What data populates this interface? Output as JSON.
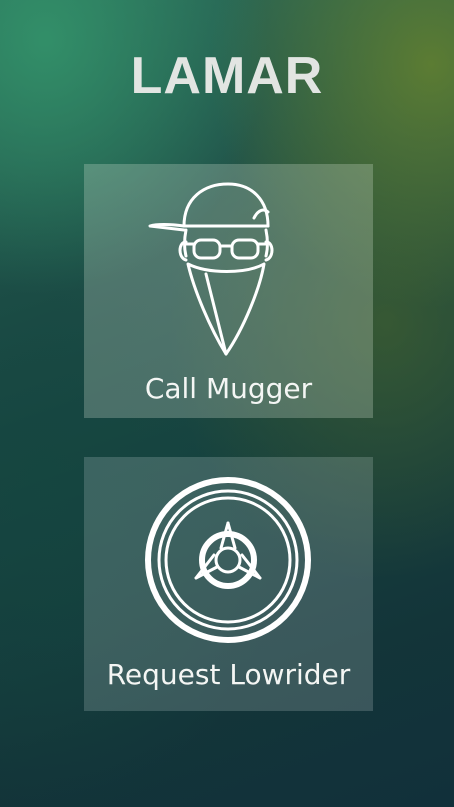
{
  "app": {
    "title": "LAMAR"
  },
  "actions": [
    {
      "label": "Call Mugger",
      "icon": "mugger-icon"
    },
    {
      "label": "Request Lowrider",
      "icon": "lowrider-wheel-icon"
    }
  ],
  "colors": {
    "title_text": "#e2e5e2",
    "tile_text": "#f4f6f4",
    "icon_stroke": "#ffffff"
  }
}
